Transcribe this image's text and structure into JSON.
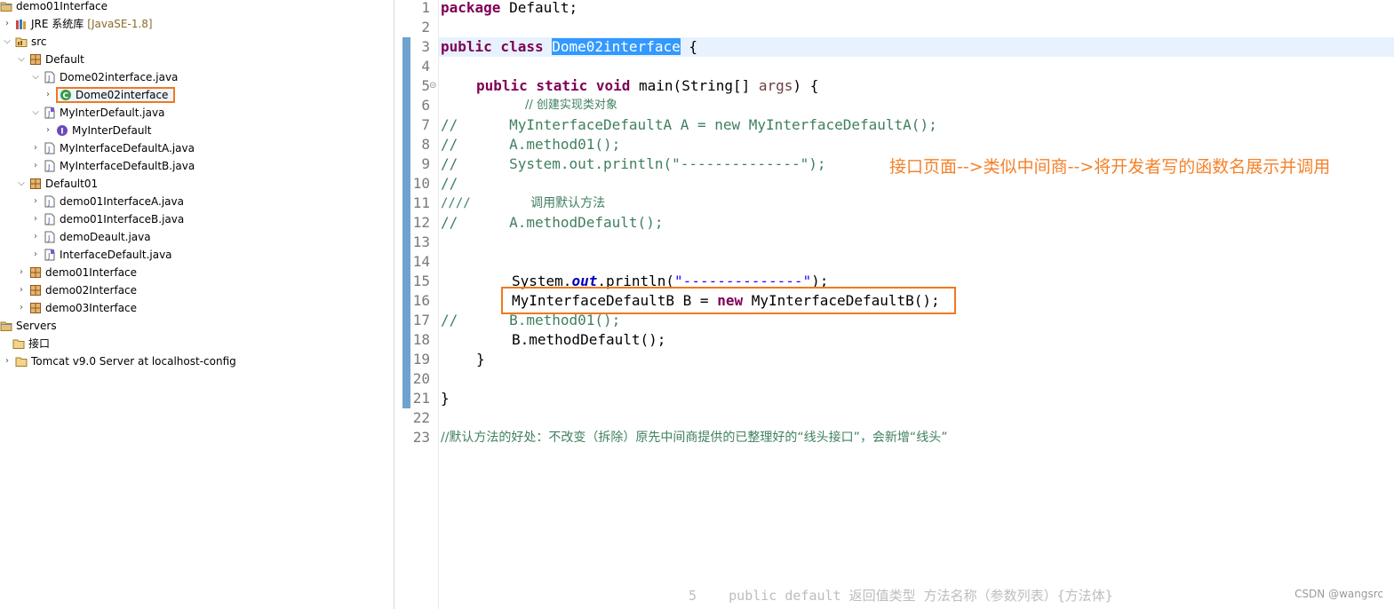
{
  "explorer": {
    "rows": [
      {
        "label": "demo01Interface"
      },
      {
        "label": "JRE 系统库",
        "decoration": "[JavaSE-1.8]"
      },
      {
        "label": "src"
      },
      {
        "label": "Default"
      },
      {
        "label": "Dome02interface.java"
      },
      {
        "label": "Dome02interface"
      },
      {
        "label": "MyInterDefault.java"
      },
      {
        "label": "MyInterDefault"
      },
      {
        "label": "MyInterfaceDefaultA.java"
      },
      {
        "label": "MyInterfaceDefaultB.java"
      },
      {
        "label": "Default01"
      },
      {
        "label": "demo01InterfaceA.java"
      },
      {
        "label": "demo01InterfaceB.java"
      },
      {
        "label": "demoDeault.java"
      },
      {
        "label": "InterfaceDefault.java"
      },
      {
        "label": "demo01Interface"
      },
      {
        "label": "demo02Interface"
      },
      {
        "label": "demo03Interface"
      },
      {
        "label": "Servers"
      },
      {
        "label": "接口"
      },
      {
        "label": "Tomcat v9.0 Server at localhost-config"
      }
    ]
  },
  "editor": {
    "line_numbers": [
      "1",
      "2",
      "3",
      "4",
      "5",
      "6",
      "7",
      "8",
      "9",
      "10",
      "11",
      "12",
      "13",
      "14",
      "15",
      "16",
      "17",
      "18",
      "19",
      "20",
      "21",
      "22",
      "23"
    ],
    "code": {
      "l1_kw": "package",
      "l1_rest": " Default;",
      "l3_kw": "public class",
      "l3_class": "Dome02interface",
      "l3_rest": " {",
      "l5_kw": "public static void",
      "l5_a": " main(String[] ",
      "l5_param": "args",
      "l5_b": ") {",
      "l6": "// 创建实现类对象",
      "l7": "//      MyInterfaceDefaultA A = new MyInterfaceDefaultA();",
      "l8": "//      A.method01();",
      "l9": "//      System.out.println(\"--------------\");",
      "l10": "//",
      "l11": "////        调用默认方法",
      "l12": "//      A.methodDefault();",
      "l15_a": "System.",
      "l15_field": "out",
      "l15_b": ".println(",
      "l15_str": "\"--------------\"",
      "l15_c": ");",
      "l16_a": "MyInterfaceDefaultB B = ",
      "l16_kw": "new",
      "l16_b": " MyInterfaceDefaultB();",
      "l17": "//      B.method01();",
      "l18": "B.methodDefault();",
      "l19": "}",
      "l21": "}",
      "l23": "//默认方法的好处：不改变（拆除）原先中间商提供的已整理好的“线头接口”，会新增“线头”"
    },
    "annotation": "接口页面-->类似中间商-->将开发者写的函数名展示并调用",
    "ghost_text": "5    public default 返回值类型 方法名称（参数列表）{方法体}",
    "watermark": "CSDN @wangsrc"
  },
  "colors": {
    "keyword": "#7f0055",
    "comment": "#3f7f5f",
    "string": "#2a00ff",
    "field": "#0000c0",
    "highlight": "#3399ff",
    "annotation": "#f5822a",
    "change_bar": "#6fa3cf"
  },
  "icons": {
    "project": "project-folder-icon",
    "library": "library-icon",
    "source": "source-folder-icon",
    "package": "package-icon",
    "java_file": "java-file-icon",
    "class": "class-icon",
    "interface": "interface-icon",
    "folder": "folder-icon"
  }
}
